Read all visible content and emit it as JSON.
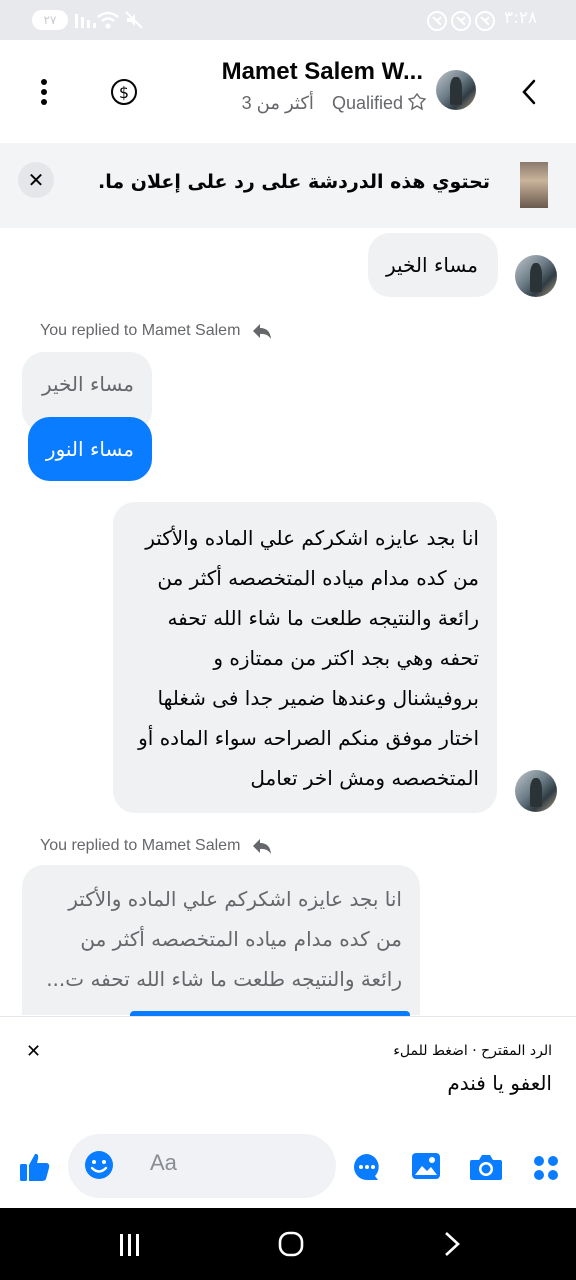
{
  "status_bar": {
    "time": "٣:٢٨",
    "battery": "٢٧"
  },
  "header": {
    "contact_name": "Mamet Salem W...",
    "label_status": "Qualified",
    "subtitle_more": "أكثر من 3",
    "icons": [
      "back-icon",
      "avatar",
      "dollar-icon",
      "more-vertical-icon"
    ]
  },
  "ad_banner": {
    "text": "تحتوي هذه الدردشة على رد على إعلان ما."
  },
  "messages": {
    "incoming_1": "مساء الخير",
    "reply_label_1": "You replied to Mamet Salem",
    "quoted_1": "مساء الخير",
    "outgoing_1": "مساء النور",
    "incoming_2_lines": [
      "انا بجد عايزه اشكركم علي الماده والأكتر",
      "من كده مدام مياده المتخصصه أكثر من",
      "رائعة والنتيجه طلعت ما شاء الله تحفه",
      "تحفه وهي بجد اكتر من ممتازه و",
      "بروفيشنال وعندها ضمير جدا فى شغلها",
      "اختار موفق منكم الصراحه سواء الماده أو",
      "المتخصصه ومش اخر تعامل"
    ],
    "reply_label_2": "You replied to Mamet Salem",
    "quoted_2_lines": [
      "انا بجد عايزه اشكركم علي الماده والأكتر",
      "من كده مدام مياده المتخصصه أكثر من",
      "رائعة والنتيجه طلعت ما شاء الله تحفه ت..."
    ]
  },
  "suggested_reply": {
    "hint": "الرد المقترح · اضغط للملء",
    "text": "العفو يا فندم"
  },
  "composer": {
    "placeholder": "Aa",
    "icons": [
      "more-apps-icon",
      "camera-icon",
      "gallery-icon",
      "chat-icon",
      "emoji-icon",
      "like-icon"
    ]
  },
  "colors": {
    "accent": "#0a7cff",
    "bubble_gray": "#f0f1f3",
    "muted_text": "#65676b"
  }
}
